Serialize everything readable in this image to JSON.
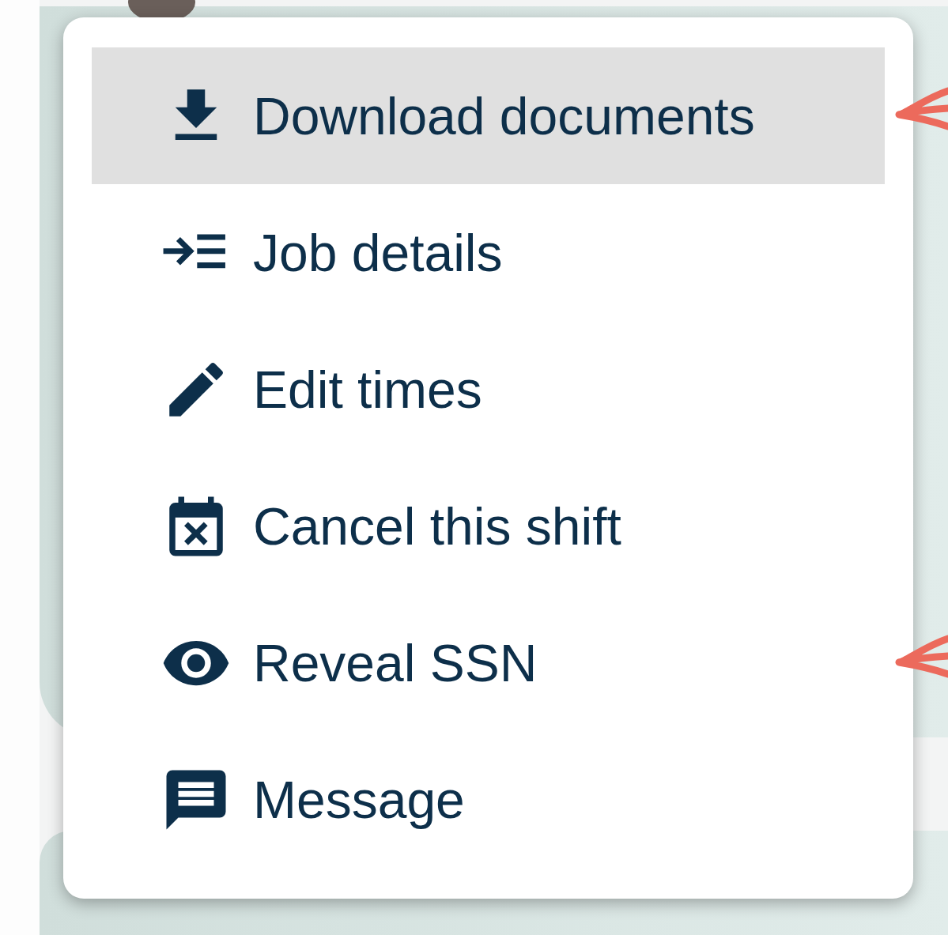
{
  "menu": {
    "items": [
      {
        "label": "Download documents",
        "selected": true
      },
      {
        "label": "Job details",
        "selected": false
      },
      {
        "label": "Edit times",
        "selected": false
      },
      {
        "label": "Cancel this shift",
        "selected": false
      },
      {
        "label": "Reveal SSN",
        "selected": false
      },
      {
        "label": "Message",
        "selected": false
      }
    ]
  }
}
